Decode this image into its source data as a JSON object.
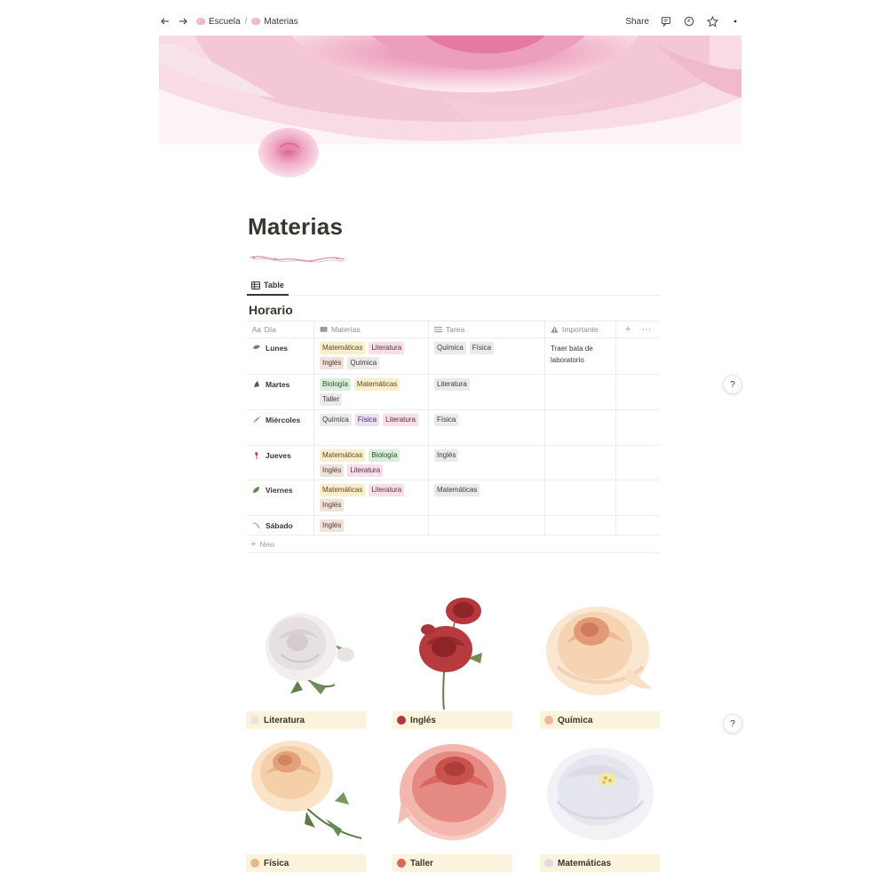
{
  "breadcrumb": {
    "items": [
      {
        "label": "Escuela"
      },
      {
        "label": "Materias"
      }
    ],
    "separator": "/"
  },
  "topbar": {
    "share_label": "Share"
  },
  "page": {
    "title": "Materias"
  },
  "views": {
    "active_tab": "Table"
  },
  "database": {
    "title": "Horario",
    "columns": {
      "dia": "Día",
      "materias": "Materias",
      "tarea": "Tarea",
      "importante": "Importante"
    },
    "new_label": "New",
    "rows": [
      {
        "dia": "Lunes",
        "materias": [
          {
            "label": "Matemáticas",
            "color": "yellow"
          },
          {
            "label": "Literatura",
            "color": "pink"
          },
          {
            "label": "Inglés",
            "color": "brown"
          },
          {
            "label": "Química",
            "color": "gray"
          }
        ],
        "tarea": [
          {
            "label": "Química",
            "color": "gray"
          },
          {
            "label": "Física",
            "color": "gray"
          }
        ],
        "importante": "Traer bata de laboratorio"
      },
      {
        "dia": "Martes",
        "materias": [
          {
            "label": "Biología",
            "color": "green"
          },
          {
            "label": "Matemáticas",
            "color": "yellow"
          },
          {
            "label": "Taller",
            "color": "gray"
          }
        ],
        "tarea": [
          {
            "label": "Literatura",
            "color": "gray"
          }
        ],
        "importante": ""
      },
      {
        "dia": "Miércoles",
        "materias": [
          {
            "label": "Química",
            "color": "gray"
          },
          {
            "label": "Física",
            "color": "purple"
          },
          {
            "label": "Literatura",
            "color": "pink"
          }
        ],
        "tarea": [
          {
            "label": "Física",
            "color": "gray"
          }
        ],
        "importante": ""
      },
      {
        "dia": "Jueves",
        "materias": [
          {
            "label": "Matemáticas",
            "color": "yellow"
          },
          {
            "label": "Biología",
            "color": "green"
          },
          {
            "label": "Inglés",
            "color": "brown"
          },
          {
            "label": "Literatura",
            "color": "pink"
          }
        ],
        "tarea": [
          {
            "label": "Inglés",
            "color": "gray"
          }
        ],
        "importante": ""
      },
      {
        "dia": "Viernes",
        "materias": [
          {
            "label": "Matemáticas",
            "color": "yellow"
          },
          {
            "label": "Literatura",
            "color": "pink"
          },
          {
            "label": "Inglés",
            "color": "brown"
          }
        ],
        "tarea": [
          {
            "label": "Matemáticas",
            "color": "gray"
          }
        ],
        "importante": ""
      },
      {
        "dia": "Sábado",
        "materias": [
          {
            "label": "Inglés",
            "color": "brown"
          }
        ],
        "tarea": [],
        "importante": ""
      }
    ]
  },
  "gallery": [
    {
      "label": "Literatura",
      "flower": "white-rose"
    },
    {
      "label": "Inglés",
      "flower": "red-carnation"
    },
    {
      "label": "Química",
      "flower": "peach-rose"
    },
    {
      "label": "Física",
      "flower": "peach-rose"
    },
    {
      "label": "Taller",
      "flower": "coral-rose"
    },
    {
      "label": "Matemáticas",
      "flower": "white-peony"
    }
  ],
  "help_label": "?",
  "tag_colors": {
    "yellow": "#fbeecc",
    "pink": "#f9dfe9",
    "brown": "#efe2da",
    "gray": "#ebeae8",
    "green": "#dbeddb",
    "purple": "#ebdff2"
  }
}
